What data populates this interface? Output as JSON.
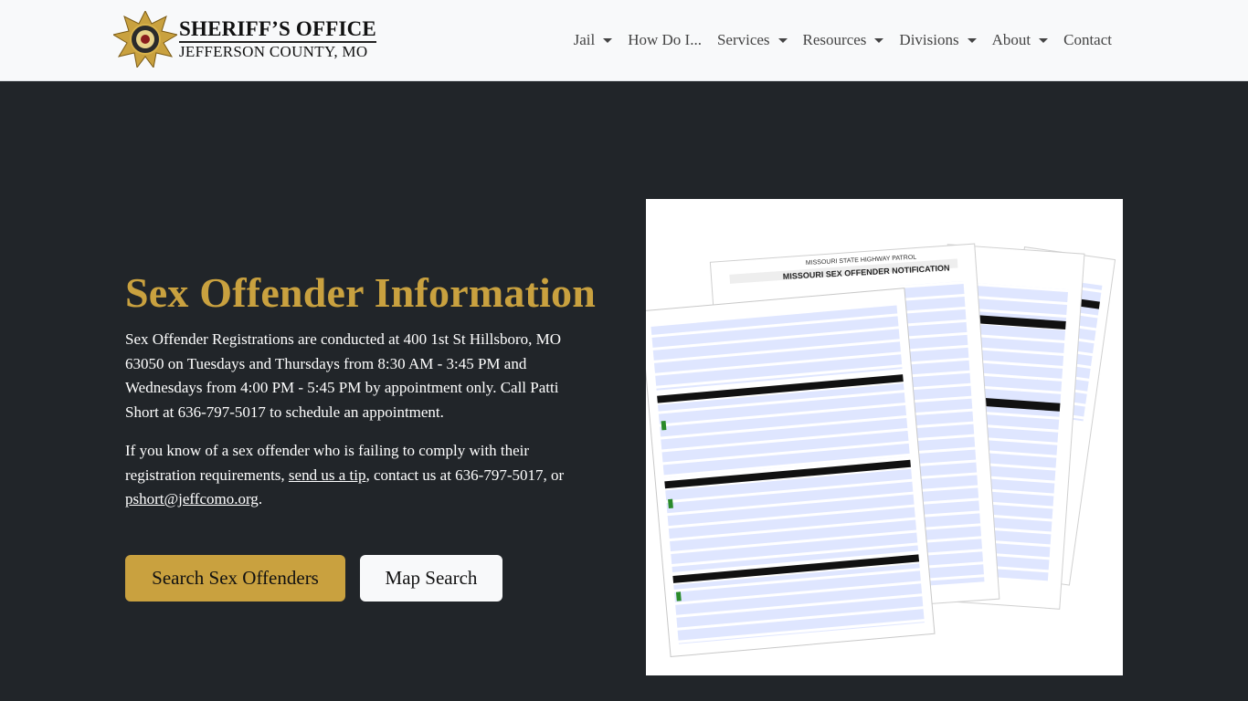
{
  "brand": {
    "line1": "SHERIFF’S OFFICE",
    "line2": "JEFFERSON COUNTY, MO"
  },
  "nav": {
    "items": [
      {
        "label": "Jail",
        "dropdown": true
      },
      {
        "label": "How Do I...",
        "dropdown": false
      },
      {
        "label": "Services",
        "dropdown": true
      },
      {
        "label": "Resources",
        "dropdown": true
      },
      {
        "label": "Divisions",
        "dropdown": true
      },
      {
        "label": "About",
        "dropdown": true
      },
      {
        "label": "Contact",
        "dropdown": false
      }
    ]
  },
  "hero": {
    "title": "Sex Offender Information",
    "paragraph1": "Sex Offender Registrations are conducted at 400 1st St Hillsboro, MO 63050 on Tuesdays and Thursdays from 8:30 AM - 3:45 PM and Wednesdays from 4:00 PM - 5:45 PM by appointment only. Call Patti Short at 636-797-5017 to schedule an appointment.",
    "paragraph2_before": "If you know of a sex offender who is failing to comply with their registration requirements, ",
    "paragraph2_link": "send us a tip",
    "paragraph2_middle": ", contact us at 636-797-5017, or ",
    "paragraph2_email": "pshort@jeffcomo.org",
    "paragraph2_end": ".",
    "btn_search": "Search Sex Offenders",
    "btn_map": "Map Search"
  },
  "image": {
    "form_title1": "MISSOURI STATE HIGHWAY PATROL",
    "form_title2": "MISSOURI SEX OFFENDER NOTIFICATION"
  },
  "colors": {
    "accent": "#c9a13f",
    "dark_bg": "#212529",
    "nav_bg": "#f8f9fa"
  }
}
